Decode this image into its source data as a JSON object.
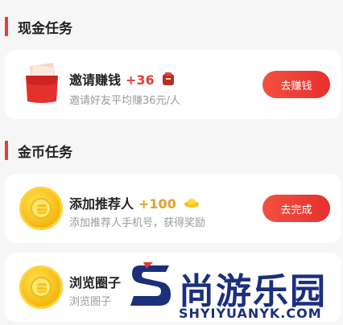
{
  "sections": {
    "cash": {
      "title": "现金任务"
    },
    "coin": {
      "title": "金币任务"
    }
  },
  "tasks": {
    "invite": {
      "name": "邀请赚钱",
      "reward": "+36",
      "desc": "邀请好友平均赚36元/人",
      "button": "去赚钱",
      "reward_color": "#e0403a"
    },
    "recommender": {
      "name": "添加推荐人",
      "reward": "+100",
      "desc": "添加推荐人手机号，获得奖励",
      "button": "去完成",
      "reward_color": "#e0a22a"
    },
    "browse": {
      "name": "浏览圈子",
      "desc": "浏览圈子"
    }
  },
  "watermark": {
    "cn": "尚游乐园",
    "en": "SHYIYUANYK.COM"
  },
  "colors": {
    "accent": "#e7302f",
    "background": "#f6f6f6"
  }
}
